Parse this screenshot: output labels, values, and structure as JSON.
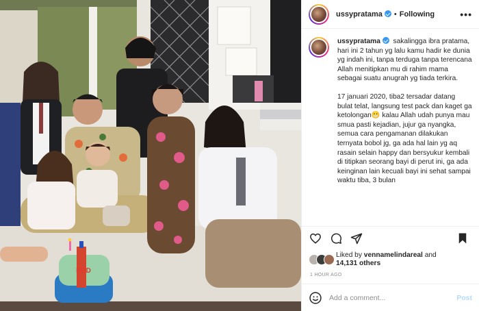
{
  "post": {
    "username": "ussypratama",
    "separator": "•",
    "follow_status": "Following",
    "more_icon": "•••"
  },
  "caption": {
    "username": "ussypratama",
    "paragraphs": [
      "sakalingga ibra pratama, hari ini 2 tahun yg lalu kamu hadir ke dunia yg indah ini, tanpa terduga tanpa terencana Allah menitipkan mu di rahim mama sebagai suatu anugrah yg tiada terkira.",
      "17 januari 2020, tiba2 tersadar datang bulat telat, langsung test pack dan kaget ga ketolongan😬 kalau Allah udah punya mau smua pasti kejadian, jujur ga nyangka, semua cara pengamanan dilakukan ternyata bobol jg, ga ada hal lain yg aq rasain selain happy dan bersyukur kembali di titipkan seorang bayi di perut ini, ga ada keinginan lain kecuali bayi ini sehat sampai waktu tiba, 3 bulan"
    ]
  },
  "likes": {
    "prefix": "Liked by",
    "liked_by": "vennamelindareal",
    "and": "and",
    "others": "14,131 others"
  },
  "timestamp": "1 HOUR AGO",
  "comment": {
    "placeholder": "Add a comment...",
    "post_label": "Post"
  },
  "photo": {
    "cake_text": "HBD"
  },
  "colors": {
    "verified": "#3897f0",
    "post_button": "#b3dbff",
    "text": "#262626",
    "muted": "#8e8e8e"
  }
}
